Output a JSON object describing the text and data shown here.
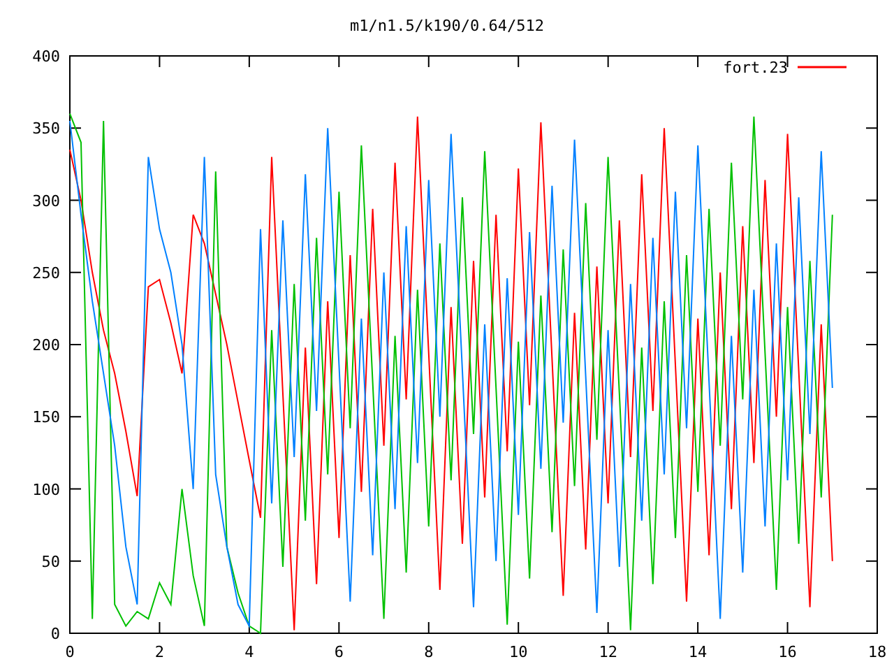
{
  "plot": {
    "chart_data": {
      "type": "line",
      "title": "m1/n1.5/k190/0.64/512",
      "xlim": [
        0,
        18
      ],
      "ylim": [
        0,
        400
      ],
      "xticks": [
        0,
        2,
        4,
        6,
        8,
        10,
        12,
        14,
        16,
        18
      ],
      "yticks": [
        0,
        50,
        100,
        150,
        200,
        250,
        300,
        350,
        400
      ],
      "x": [
        0,
        0.25,
        0.5,
        0.75,
        1,
        1.25,
        1.5,
        1.75,
        2,
        2.25,
        2.5,
        2.75,
        3,
        3.25,
        3.5,
        3.75,
        4,
        4.25,
        4.5,
        4.75,
        5,
        5.25,
        5.5,
        5.75,
        6,
        6.25,
        6.5,
        6.75,
        7,
        7.25,
        7.5,
        7.75,
        8,
        8.25,
        8.5,
        8.75,
        9,
        9.25,
        9.5,
        9.75,
        10,
        10.25,
        10.5,
        10.75,
        11,
        11.25,
        11.5,
        11.75,
        12,
        12.25,
        12.5,
        12.75,
        13,
        13.25,
        13.5,
        13.75,
        14,
        14.25,
        14.5,
        14.75,
        15,
        15.25,
        15.5,
        15.75,
        16,
        16.25,
        16.5,
        16.75,
        17
      ],
      "series": [
        {
          "name": "fort.23",
          "color": "#ff0000",
          "values": [
            335,
            300,
            250,
            210,
            180,
            140,
            95,
            240,
            245,
            215,
            180,
            290,
            270,
            235,
            200,
            160,
            120,
            80,
            330,
            166,
            2,
            198,
            34,
            230,
            66,
            262,
            98,
            294,
            130,
            326,
            162,
            358,
            194,
            30,
            226,
            62,
            258,
            94,
            290,
            126,
            322,
            158,
            354,
            190,
            26,
            222,
            58,
            254,
            90,
            286,
            122,
            318,
            154,
            350,
            186,
            22,
            218,
            54,
            250,
            86,
            282,
            118,
            314,
            150,
            346,
            182,
            18,
            214,
            50
          ]
        },
        {
          "color": "#00c000",
          "values": [
            360,
            340,
            10,
            355,
            20,
            5,
            15,
            10,
            35,
            20,
            100,
            40,
            5,
            320,
            60,
            28,
            5,
            0,
            210,
            46,
            242,
            78,
            274,
            110,
            306,
            142,
            338,
            174,
            10,
            206,
            42,
            238,
            74,
            270,
            106,
            302,
            138,
            334,
            170,
            6,
            202,
            38,
            234,
            70,
            266,
            102,
            298,
            134,
            330,
            166,
            2,
            198,
            34,
            230,
            66,
            262,
            98,
            294,
            130,
            326,
            162,
            358,
            194,
            30,
            226,
            62,
            258,
            94,
            290
          ]
        },
        {
          "color": "#0080ff",
          "values": [
            355,
            290,
            230,
            180,
            130,
            60,
            20,
            330,
            280,
            250,
            200,
            100,
            330,
            110,
            60,
            20,
            5,
            280,
            90,
            286,
            122,
            318,
            154,
            350,
            186,
            22,
            218,
            54,
            250,
            86,
            282,
            118,
            314,
            150,
            346,
            182,
            18,
            214,
            50,
            246,
            82,
            278,
            114,
            310,
            146,
            342,
            178,
            14,
            210,
            46,
            242,
            78,
            274,
            110,
            306,
            142,
            338,
            174,
            10,
            206,
            42,
            238,
            74,
            270,
            106,
            302,
            138,
            334,
            170
          ]
        }
      ]
    }
  }
}
